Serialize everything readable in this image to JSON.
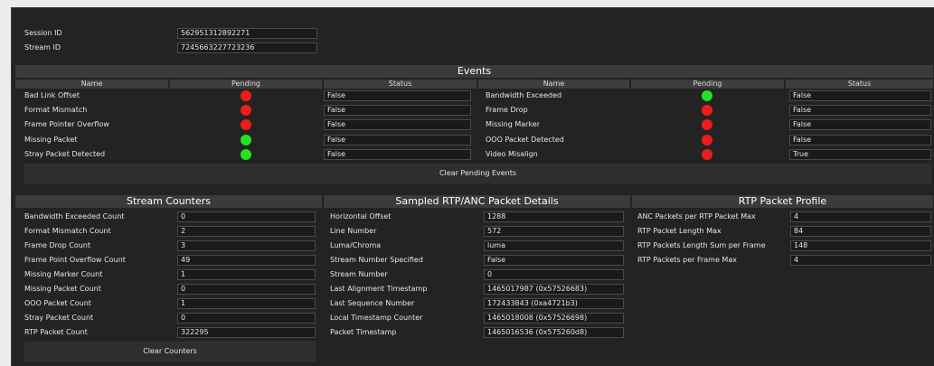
{
  "header": {
    "session_label": "Session ID",
    "session_value": "562951312892271",
    "stream_label": "Stream ID",
    "stream_value": "7245663227723236"
  },
  "events": {
    "title": "Events",
    "columns": [
      "Name",
      "Pending",
      "Status",
      "Name",
      "Pending",
      "Status"
    ],
    "left": [
      {
        "name": "Bad Link Offset",
        "pending": "red",
        "status": "False"
      },
      {
        "name": "Format Mismatch",
        "pending": "red",
        "status": "False"
      },
      {
        "name": "Frame Pointer Overflow",
        "pending": "red",
        "status": "False"
      },
      {
        "name": "Missing Packet",
        "pending": "green",
        "status": "False"
      },
      {
        "name": "Stray Packet Detected",
        "pending": "green",
        "status": "False"
      }
    ],
    "right": [
      {
        "name": "Bandwidth Exceeded",
        "pending": "green",
        "status": "False"
      },
      {
        "name": "Frame Drop",
        "pending": "red",
        "status": "False"
      },
      {
        "name": "Missing Marker",
        "pending": "red",
        "status": "False"
      },
      {
        "name": "OOO Packet Detected",
        "pending": "red",
        "status": "False"
      },
      {
        "name": "Video Misalign",
        "pending": "red",
        "status": "True"
      }
    ],
    "clear_button": "Clear Pending Events"
  },
  "stream_counters": {
    "title": "Stream Counters",
    "rows": [
      {
        "label": "Bandwidth Exceeded Count",
        "value": "0"
      },
      {
        "label": "Format Mismatch Count",
        "value": "2"
      },
      {
        "label": "Frame Drop Count",
        "value": "3"
      },
      {
        "label": "Frame Point Overflow Count",
        "value": "49"
      },
      {
        "label": "Missing Marker Count",
        "value": "1"
      },
      {
        "label": "Missing Packet Count",
        "value": "0"
      },
      {
        "label": "OOO Packet Count",
        "value": "1"
      },
      {
        "label": "Stray Packet Count",
        "value": "0"
      },
      {
        "label": "RTP Packet Count",
        "value": "322295"
      }
    ],
    "clear_button": "Clear Counters"
  },
  "sampled_details": {
    "title": "Sampled RTP/ANC Packet Details",
    "rows": [
      {
        "label": "Horizontal Offset",
        "value": "1288"
      },
      {
        "label": "Line Number",
        "value": "572"
      },
      {
        "label": "Luma/Chroma",
        "value": "luma"
      },
      {
        "label": "Stream Number Specified",
        "value": "False"
      },
      {
        "label": "Stream Number",
        "value": "0"
      },
      {
        "label": "Last Alignment Timestamp",
        "value": "1465017987 (0x57526683)"
      },
      {
        "label": "Last Sequence Number",
        "value": "172433843 (0xa4721b3)"
      },
      {
        "label": "Local Timestamp Counter",
        "value": "1465018008 (0x57526698)"
      },
      {
        "label": "Packet Timestamp",
        "value": "1465016536 (0x575260d8)"
      }
    ]
  },
  "rtp_profile": {
    "title": "RTP Packet Profile",
    "rows": [
      {
        "label": "ANC Packets per RTP Packet Max",
        "value": "4"
      },
      {
        "label": "RTP Packet Length Max",
        "value": "84"
      },
      {
        "label": "RTP Packets Length Sum per Frame",
        "value": "148"
      },
      {
        "label": "RTP Packets per Frame Max",
        "value": "4"
      }
    ]
  },
  "colors": {
    "red": "#ee1c1c",
    "green": "#22e51f"
  }
}
